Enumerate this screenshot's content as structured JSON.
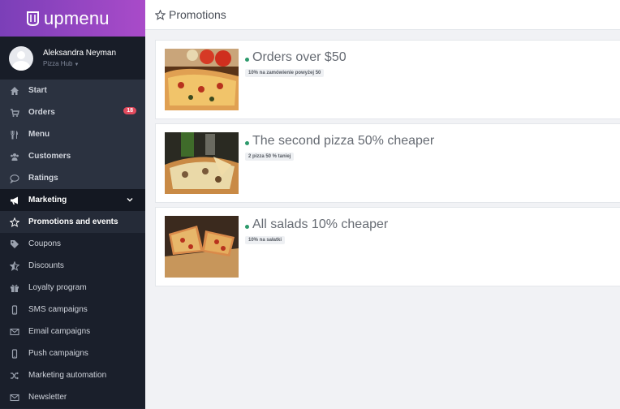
{
  "brand": {
    "name": "upmenu"
  },
  "user": {
    "name": "Aleksandra Neyman",
    "restaurant": "Pizza Hub"
  },
  "nav": {
    "main": [
      {
        "label": "Start",
        "icon": "home-icon"
      },
      {
        "label": "Orders",
        "icon": "cart-icon",
        "badge": "18"
      },
      {
        "label": "Menu",
        "icon": "cutlery-icon"
      },
      {
        "label": "Customers",
        "icon": "users-icon"
      },
      {
        "label": "Ratings",
        "icon": "comment-icon"
      }
    ],
    "section": {
      "label": "Marketing",
      "icon": "megaphone-icon"
    },
    "sub": [
      {
        "label": "Promotions and events",
        "icon": "star-icon"
      },
      {
        "label": "Coupons",
        "icon": "tag-icon"
      },
      {
        "label": "Discounts",
        "icon": "star-half-icon"
      },
      {
        "label": "Loyalty program",
        "icon": "gift-icon"
      },
      {
        "label": "SMS campaigns",
        "icon": "mobile-icon"
      },
      {
        "label": "Email campaigns",
        "icon": "envelope-icon"
      },
      {
        "label": "Push campaigns",
        "icon": "mobile-icon"
      },
      {
        "label": "Marketing automation",
        "icon": "shuffle-icon"
      },
      {
        "label": "Newsletter",
        "icon": "envelope-icon"
      }
    ]
  },
  "header": {
    "title": "Promotions"
  },
  "promotions": [
    {
      "name": "Orders over $50",
      "tag": "10% na zamówienie powyżej 50",
      "status_color": "#2d9a6c"
    },
    {
      "name": "The second pizza 50% cheaper",
      "tag": "2 pizza 50 % taniej",
      "status_color": "#2d9a6c"
    },
    {
      "name": "All salads 10% cheaper",
      "tag": "10% na sałatki",
      "status_color": "#2d9a6c"
    }
  ],
  "colors": {
    "brand_gradient_start": "#7b3fb8",
    "brand_gradient_end": "#a94bc9",
    "sidebar": "#1f2532",
    "badge": "#e24b5e",
    "active_dot": "#2d9a6c"
  }
}
